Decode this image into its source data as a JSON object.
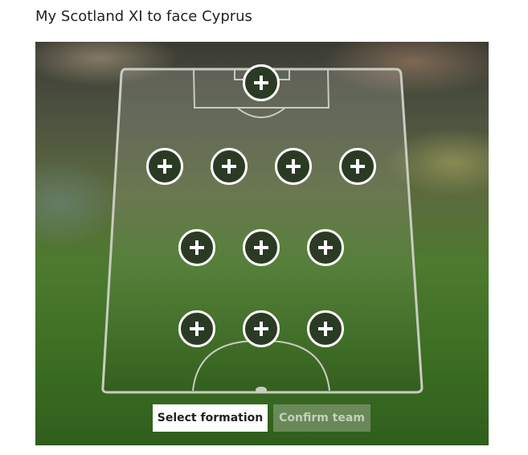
{
  "title": "My Scotland XI to face Cyprus",
  "pitch": {
    "formation_rows": [
      {
        "position": "goalkeeper",
        "slots": 1
      },
      {
        "position": "defence",
        "slots": 4
      },
      {
        "position": "midfield",
        "slots": 3
      },
      {
        "position": "attack",
        "slots": 3
      }
    ],
    "slot_icon": "plus-icon"
  },
  "buttons": {
    "select_formation": "Select formation",
    "confirm_team": "Confirm team",
    "confirm_team_state": "disabled"
  },
  "colors": {
    "pitch_green": "#3e7024",
    "line_white": "#ffffff",
    "slot_fill": "#2b3a24",
    "title_text": "#222222"
  }
}
